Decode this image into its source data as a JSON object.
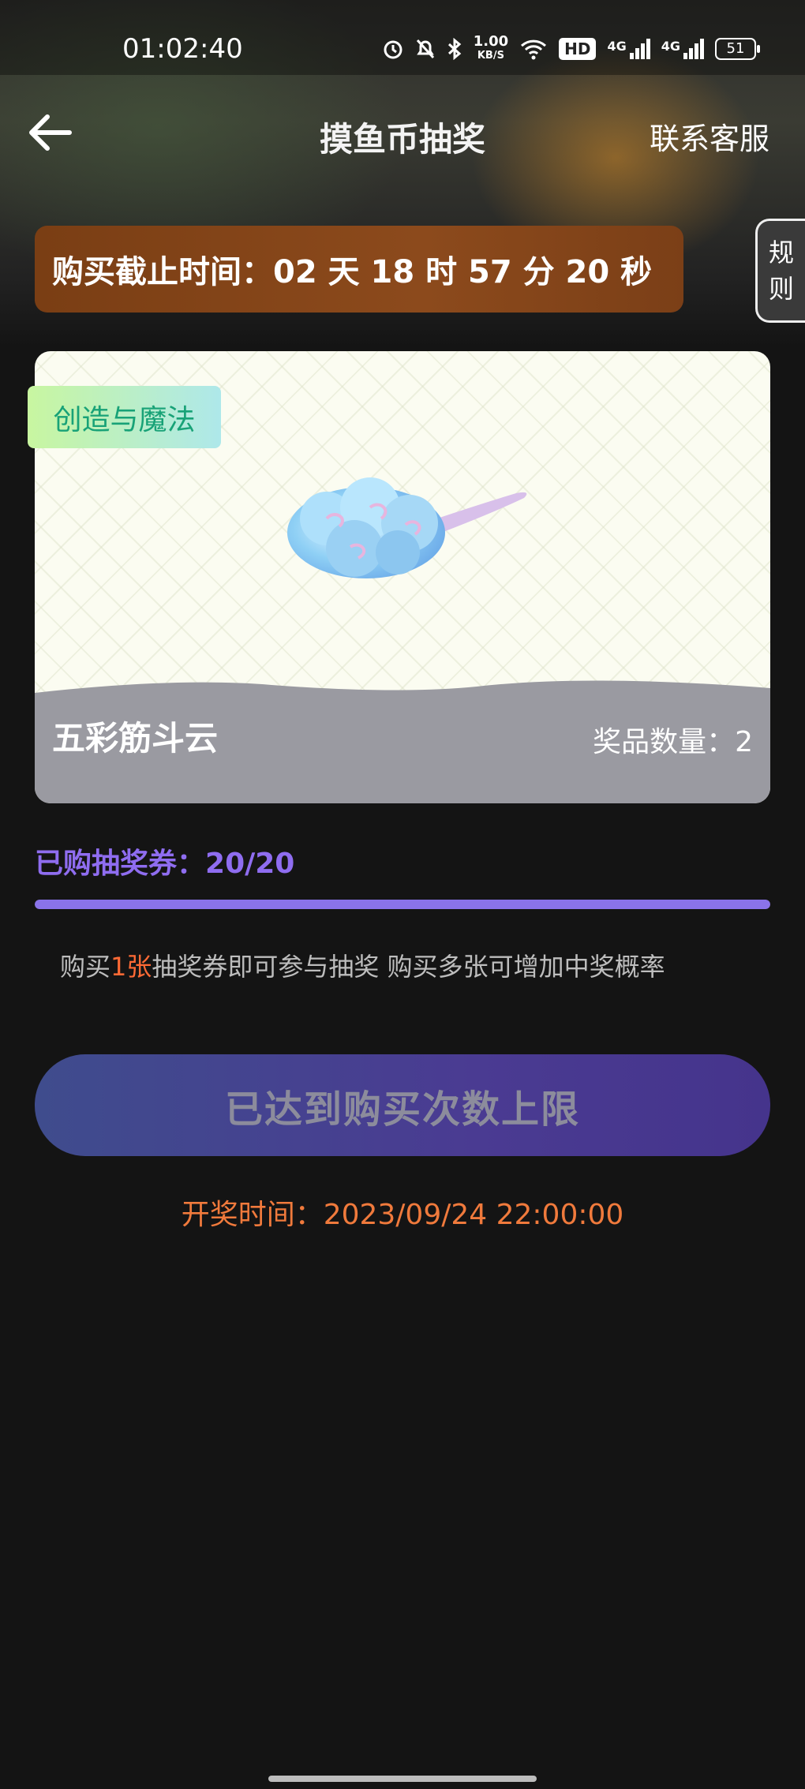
{
  "status_bar": {
    "time": "01:02:40",
    "net_speed_value": "1.00",
    "net_speed_unit": "KB/S",
    "hd_label": "HD",
    "signal1_label": "4G",
    "signal2_label": "4G",
    "battery": "51"
  },
  "header": {
    "title": "摸鱼币抽奖",
    "service_link": "联系客服"
  },
  "countdown": {
    "text": "购买截止时间：02 天 18 时 57 分 20 秒"
  },
  "rules_tab": {
    "line1": "规",
    "line2": "则"
  },
  "prize": {
    "category": "创造与魔法",
    "name": "五彩筋斗云",
    "quantity_label": "奖品数量：",
    "quantity": "2"
  },
  "tickets": {
    "label": "已购抽奖券：",
    "count": "20/20",
    "progress": 1.0
  },
  "hint": {
    "before": "购买",
    "highlight": "1张",
    "after": "抽奖券即可参与抽奖 购买多张可增加中奖概率"
  },
  "buy_button": {
    "label": "已达到购买次数上限"
  },
  "draw_time": {
    "text": "开奖时间：2023/09/24 22:00:00"
  },
  "colors": {
    "accent_purple": "#8f6df0",
    "highlight_orange": "#ff6a35",
    "draw_time_orange": "#f07a3c"
  }
}
